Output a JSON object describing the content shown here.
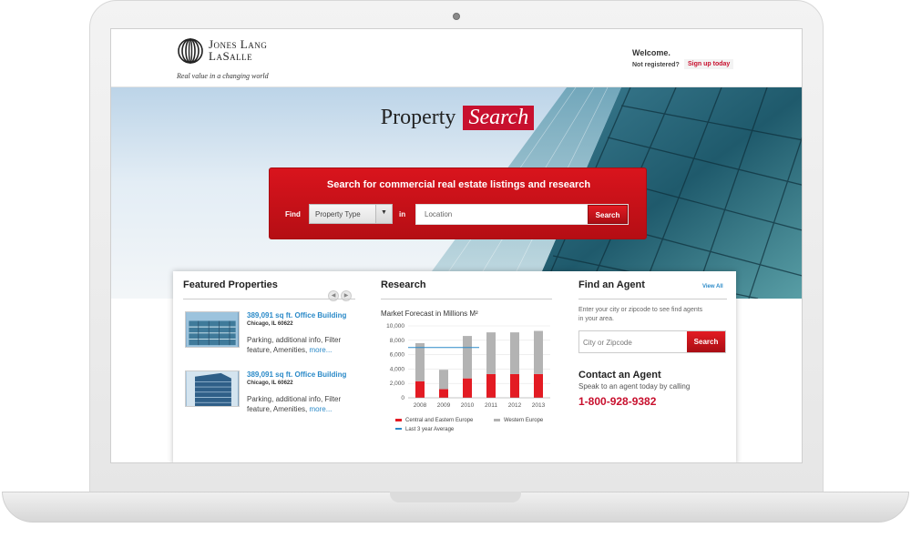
{
  "header": {
    "logo_line1": "Jones Lang",
    "logo_line2": "LaSalle",
    "tagline": "Real value in a changing world",
    "welcome": "Welcome.",
    "not_registered": "Not registered?",
    "signup": "Sign up today"
  },
  "hero": {
    "title_plain": "Property",
    "title_red": "Search"
  },
  "search": {
    "heading": "Search for commercial real estate listings and research",
    "find_label": "Find",
    "property_type": "Property Type",
    "in_label": "in",
    "location_placeholder": "Location",
    "button": "Search"
  },
  "featured": {
    "title": "Featured Properties",
    "items": [
      {
        "title": "389,091 sq ft. Office Building",
        "city": "Chicago, IL 60622",
        "desc": "Parking, additional info, Filter feature, Amenities,",
        "more": "more..."
      },
      {
        "title": "389,091 sq ft. Office Building",
        "city": "Chicago, IL 60622",
        "desc": "Parking, additional info, Filter feature, Amenities,",
        "more": "more..."
      }
    ]
  },
  "research": {
    "title": "Research",
    "chart_title": "Market Forecast in Millions M²"
  },
  "agent": {
    "title": "Find an Agent",
    "view_all": "View All",
    "text": "Enter your city or zipcode to see find agents in your area.",
    "zip_placeholder": "City or Zipcode",
    "button": "Search",
    "contact_title": "Contact an Agent",
    "contact_text": "Speak to an agent today by calling",
    "phone": "1-800-928-9382"
  },
  "chart_data": {
    "type": "bar",
    "title": "Market Forecast in Millions M²",
    "categories": [
      "2008",
      "2009",
      "2010",
      "2011",
      "2012",
      "2013"
    ],
    "series": [
      {
        "name": "Central and Eastern Europe",
        "color": "#e31b23",
        "values": [
          2300,
          1200,
          2700,
          3300,
          3300,
          3300
        ]
      },
      {
        "name": "Western Europe",
        "color": "#b3b3b3",
        "values": [
          5300,
          2700,
          5900,
          5800,
          5800,
          6000
        ]
      }
    ],
    "reference_line": {
      "name": "Last 3 year Average",
      "color": "#2b8ac8",
      "value": 7000
    },
    "yticks": [
      "0",
      "2,000",
      "4,000",
      "6,000",
      "8,000",
      "10,000"
    ],
    "ylim": [
      0,
      10000
    ]
  }
}
